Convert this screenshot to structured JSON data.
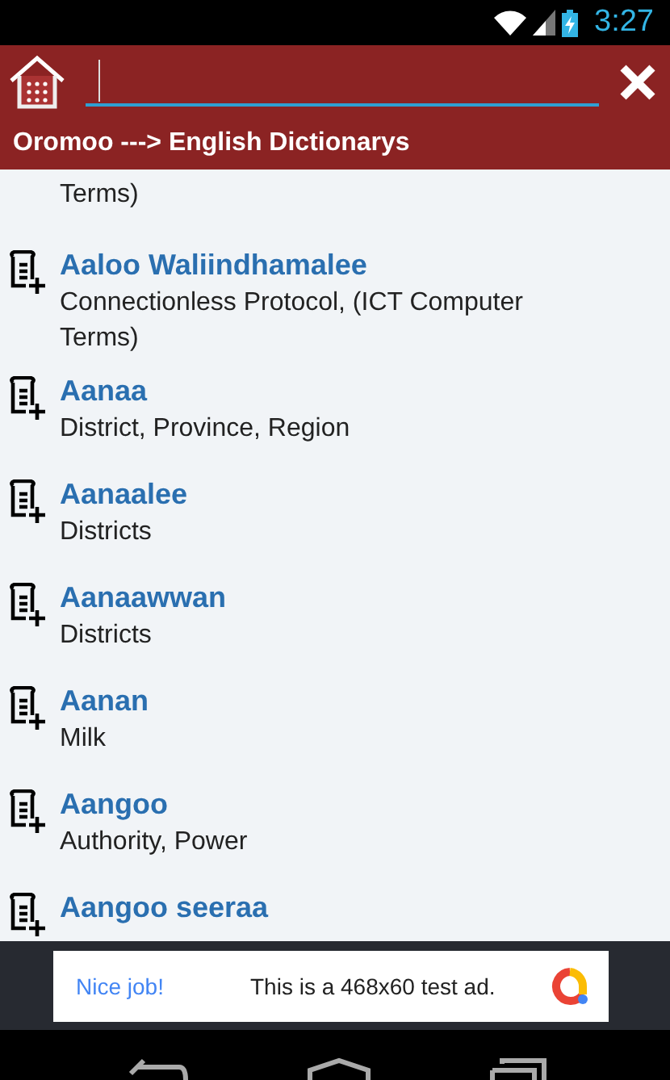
{
  "status_bar": {
    "time": "3:27"
  },
  "header": {
    "title": "Oromoo ---> English Dictionarys"
  },
  "list": {
    "partial_top": "Terms)",
    "entries": [
      {
        "word": "Aaloo Waliindhamalee",
        "meaning": "Connectionless Protocol, (ICT Computer Terms)"
      },
      {
        "word": "Aanaa",
        "meaning": "District, Province, Region"
      },
      {
        "word": "Aanaalee",
        "meaning": "Districts"
      },
      {
        "word": "Aanaawwan",
        "meaning": "Districts"
      },
      {
        "word": "Aanan",
        "meaning": "Milk"
      },
      {
        "word": "Aangoo",
        "meaning": "Authority, Power"
      },
      {
        "word": "Aangoo seeraa"
      }
    ]
  },
  "ad": {
    "headline": "Nice job!",
    "text": "This is a 468x60 test ad."
  }
}
